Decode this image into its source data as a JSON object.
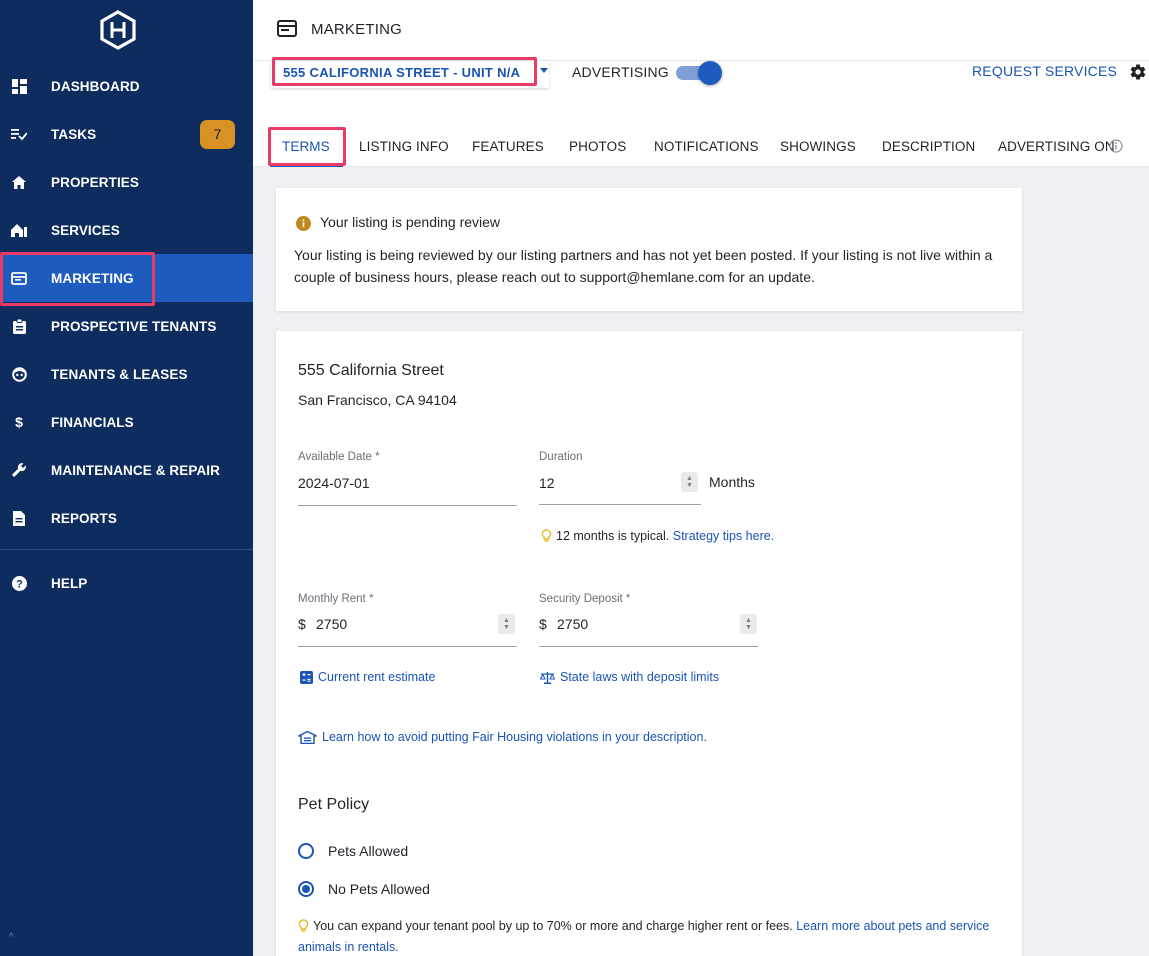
{
  "sidebar": {
    "items": [
      {
        "key": "dashboard",
        "label": "DASHBOARD",
        "icon": "dashboard-icon"
      },
      {
        "key": "tasks",
        "label": "TASKS",
        "icon": "tasks-icon",
        "badge": "7"
      },
      {
        "key": "properties",
        "label": "PROPERTIES",
        "icon": "home-icon"
      },
      {
        "key": "services",
        "label": "SERVICES",
        "icon": "services-icon"
      },
      {
        "key": "marketing",
        "label": "MARKETING",
        "icon": "marketing-icon",
        "active": true
      },
      {
        "key": "prospective",
        "label": "PROSPECTIVE TENANTS",
        "icon": "clipboard-icon"
      },
      {
        "key": "tenants",
        "label": "TENANTS & LEASES",
        "icon": "face-icon"
      },
      {
        "key": "financials",
        "label": "FINANCIALS",
        "icon": "dollar-icon"
      },
      {
        "key": "maintenance",
        "label": "MAINTENANCE & REPAIR",
        "icon": "wrench-icon"
      },
      {
        "key": "reports",
        "label": "REPORTS",
        "icon": "report-icon"
      },
      {
        "key": "help",
        "label": "HELP",
        "icon": "help-icon"
      }
    ]
  },
  "header": {
    "title": "MARKETING"
  },
  "subbar": {
    "property_select": "555 CALIFORNIA STREET - UNIT N/A",
    "advertising_label": "ADVERTISING",
    "advertising_on": true,
    "request_services": "REQUEST SERVICES"
  },
  "tabs": [
    {
      "label": "TERMS",
      "active": true
    },
    {
      "label": "LISTING INFO"
    },
    {
      "label": "FEATURES"
    },
    {
      "label": "PHOTOS"
    },
    {
      "label": "NOTIFICATIONS"
    },
    {
      "label": "SHOWINGS"
    },
    {
      "label": "DESCRIPTION"
    },
    {
      "label": "ADVERTISING ON"
    }
  ],
  "alert": {
    "title": "Your listing is pending review",
    "body": "Your listing is being reviewed by our listing partners and has not yet been posted. If your listing is not live within a couple of business hours, please reach out to support@hemlane.com for an update."
  },
  "form": {
    "address_line1": "555 California Street",
    "address_line2": "San Francisco, CA 94104",
    "available_date": {
      "label": "Available Date *",
      "value": "2024-07-01"
    },
    "duration": {
      "label": "Duration",
      "value": "12",
      "unit": "Months"
    },
    "duration_tip": "12 months is typical.",
    "duration_tip_link": "Strategy tips here.",
    "monthly_rent": {
      "label": "Monthly Rent *",
      "prefix": "$",
      "value": "2750"
    },
    "security_deposit": {
      "label": "Security Deposit *",
      "prefix": "$",
      "value": "2750"
    },
    "rent_estimate_link": "Current rent estimate",
    "deposit_limits_link": "State laws with deposit limits",
    "fair_housing_link": "Learn how to avoid putting Fair Housing violations in your description.",
    "pet_policy_title": "Pet Policy",
    "pet_options": [
      {
        "label": "Pets Allowed",
        "checked": false
      },
      {
        "label": "No Pets Allowed",
        "checked": true
      }
    ],
    "pet_tip": "You can expand your tenant pool by up to 70% or more and charge higher rent or fees.",
    "pet_tip_link": "Learn more about pets and service animals in rentals."
  },
  "colors": {
    "sidebar_bg": "#0e2d5e",
    "active_bg": "#1d5bbf",
    "accent": "#1a54b4",
    "badge": "#d89224",
    "highlight": "#ea3b67"
  }
}
